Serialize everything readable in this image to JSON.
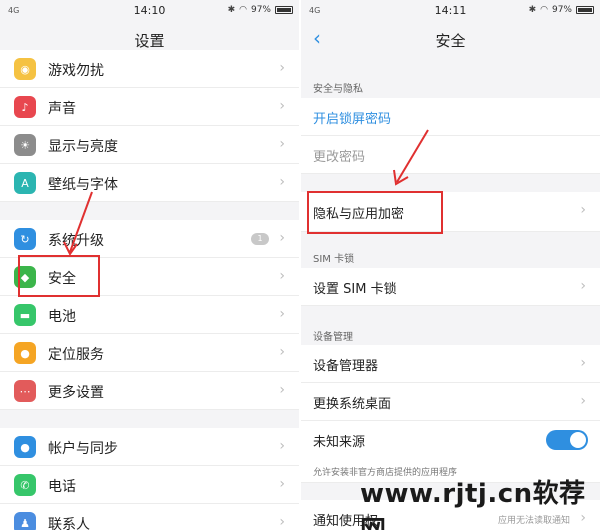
{
  "left": {
    "status": {
      "network": "4G",
      "time": "14:10",
      "battery": "97%"
    },
    "title": "设置",
    "items": [
      {
        "label": "游戏勿扰",
        "icon": "game-icon",
        "color": "#f5c242"
      },
      {
        "label": "声音",
        "icon": "sound-icon",
        "color": "#e8474f"
      },
      {
        "label": "显示与亮度",
        "icon": "brightness-icon",
        "color": "#8c8c8c"
      },
      {
        "label": "壁纸与字体",
        "icon": "font-icon",
        "color": "#2bb5b1"
      },
      {
        "label": "系统升级",
        "icon": "update-icon",
        "color": "#2f8fe0",
        "badge": "1"
      },
      {
        "label": "安全",
        "icon": "shield-icon",
        "color": "#3bb54a"
      },
      {
        "label": "电池",
        "icon": "battery-icon",
        "color": "#36c66a"
      },
      {
        "label": "定位服务",
        "icon": "location-icon",
        "color": "#f5a524"
      },
      {
        "label": "更多设置",
        "icon": "more-icon",
        "color": "#e25b5b"
      },
      {
        "label": "帐户与同步",
        "icon": "account-icon",
        "color": "#2f8fe0"
      },
      {
        "label": "电话",
        "icon": "phone-icon",
        "color": "#36c66a"
      },
      {
        "label": "联系人",
        "icon": "contacts-icon",
        "color": "#4b8de0"
      }
    ]
  },
  "right": {
    "status": {
      "network": "4G",
      "time": "14:11",
      "battery": "97%"
    },
    "title": "安全",
    "section_privacy": "安全与隐私",
    "lock_password": "开启锁屏密码",
    "change_password": "更改密码",
    "privacy_encrypt": "隐私与应用加密",
    "section_sim": "SIM 卡锁",
    "sim_lock": "设置 SIM 卡锁",
    "section_device": "设备管理",
    "device_manager": "设备管理器",
    "change_desktop": "更换系统桌面",
    "unknown_sources": "未知来源",
    "unknown_hint": "允许安装非官方商店提供的应用程序",
    "notify_access": "通知使用权",
    "notify_hint": "应用无法读取通知"
  },
  "watermark": "www.rjtj.cn软荐网"
}
